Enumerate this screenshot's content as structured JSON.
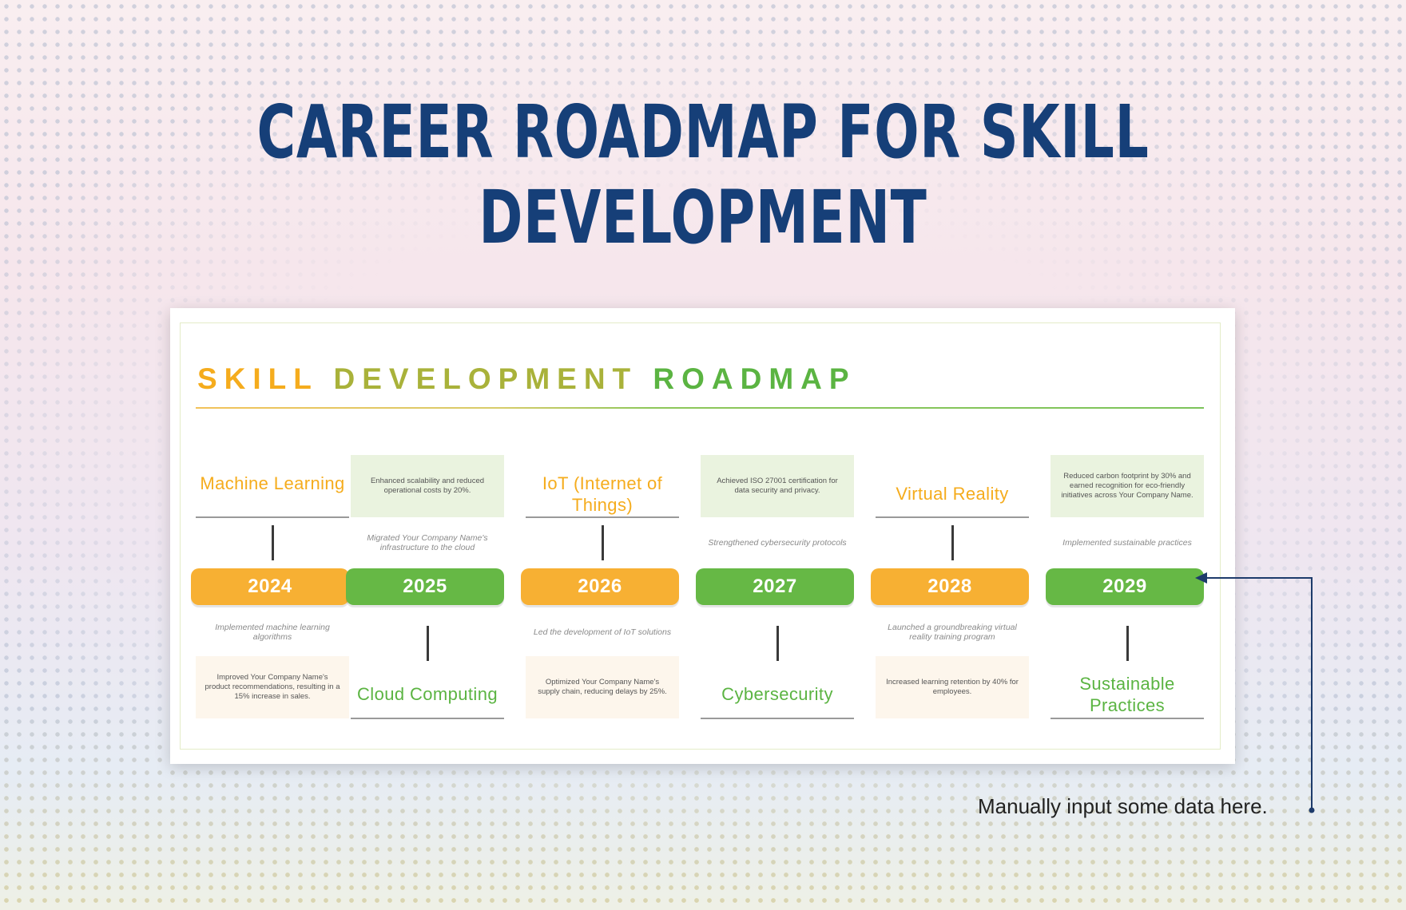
{
  "title": "CAREER ROADMAP FOR SKILL DEVELOPMENT",
  "roadmap": {
    "title_parts": [
      "SKILL",
      "DEVELOPMENT",
      "ROADMAP"
    ]
  },
  "colors": {
    "orange": "#f7b033",
    "green": "#66b845",
    "navy": "#163f78"
  },
  "milestones": [
    {
      "year": "2024",
      "skill": "Machine Learning",
      "caption": "Implemented machine learning algorithms",
      "result": "Improved Your Company Name's product recommendations, resulting in a 15% increase in sales.",
      "color": "orange"
    },
    {
      "year": "2025",
      "skill": "Cloud Computing",
      "caption": "Migrated Your Company Name's infrastructure to the cloud",
      "result": "Enhanced scalability and reduced operational costs by 20%.",
      "color": "green"
    },
    {
      "year": "2026",
      "skill": "IoT (Internet of Things)",
      "caption": "Led the development of IoT solutions",
      "result": "Optimized Your Company Name's supply chain, reducing delays by 25%.",
      "color": "orange"
    },
    {
      "year": "2027",
      "skill": "Cybersecurity",
      "caption": "Strengthened cybersecurity protocols",
      "result": "Achieved ISO 27001 certification for data security and privacy.",
      "color": "green"
    },
    {
      "year": "2028",
      "skill": "Virtual Reality",
      "caption": "Launched a groundbreaking virtual reality training program",
      "result": "Increased learning retention by 40% for employees.",
      "color": "orange"
    },
    {
      "year": "2029",
      "skill": "Sustainable Practices",
      "caption": "Implemented sustainable practices",
      "result": "Reduced carbon footprint by 30% and earned recognition for eco-friendly initiatives across Your Company Name.",
      "color": "green"
    }
  ],
  "annotation": "Manually input some data here."
}
